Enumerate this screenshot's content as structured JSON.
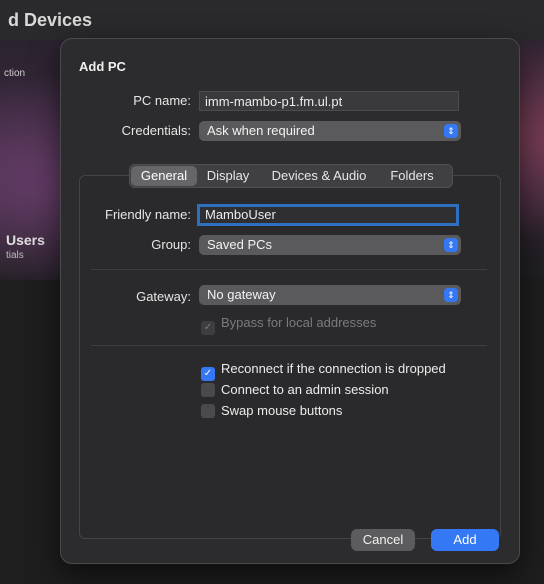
{
  "background": {
    "title": "d Devices",
    "side_top": "ction",
    "side_users": "Users",
    "side_sub": "tials"
  },
  "sheet": {
    "title": "Add PC",
    "pc_name_label": "PC name:",
    "pc_name_value": "imm-mambo-p1.fm.ul.pt",
    "credentials_label": "Credentials:",
    "credentials_value": "Ask when required",
    "tabs": [
      {
        "label": "General",
        "active": true
      },
      {
        "label": "Display"
      },
      {
        "label": "Devices & Audio"
      },
      {
        "label": "Folders"
      }
    ],
    "friendly_name_label": "Friendly name:",
    "friendly_name_value": "MamboUser",
    "group_label": "Group:",
    "group_value": "Saved PCs",
    "gateway_label": "Gateway:",
    "gateway_value": "No gateway",
    "bypass_label": "Bypass for local addresses",
    "reconnect_label": "Reconnect if the connection is dropped",
    "admin_label": "Connect to an admin session",
    "swap_label": "Swap mouse buttons",
    "cancel_label": "Cancel",
    "add_label": "Add"
  },
  "colors": {
    "accent": "#3478f6",
    "sheet_bg": "#2c2c2e"
  }
}
